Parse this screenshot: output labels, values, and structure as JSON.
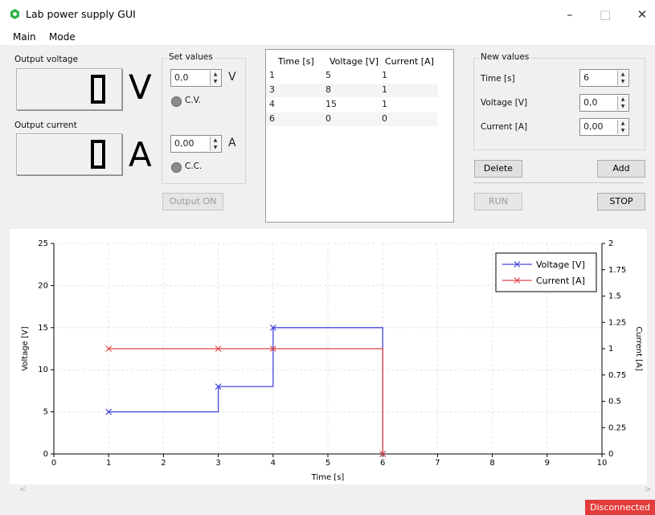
{
  "window": {
    "title": "Lab power supply GUI",
    "controls": [
      "–",
      "□",
      "✕"
    ]
  },
  "menu": {
    "items": [
      "Main",
      "Mode"
    ]
  },
  "output": {
    "voltage_label": "Output voltage",
    "voltage_digit": "0",
    "voltage_unit": "V",
    "current_label": "Output current",
    "current_digit": "0",
    "current_unit": "A"
  },
  "set_values": {
    "title": "Set values",
    "voltage_value": "0,0",
    "voltage_unit": "V",
    "cv_label": "C.V.",
    "current_value": "0,00",
    "current_unit": "A",
    "cc_label": "C.C.",
    "output_button": "Output ON"
  },
  "table": {
    "columns": [
      "Time [s]",
      "Voltage [V]",
      "Current [A]"
    ],
    "rows": [
      [
        "1",
        "5",
        "1"
      ],
      [
        "3",
        "8",
        "1"
      ],
      [
        "4",
        "15",
        "1"
      ],
      [
        "6",
        "0",
        "0"
      ]
    ]
  },
  "new_values": {
    "title": "New values",
    "time_label": "Time [s]",
    "time_value": "6",
    "voltage_label": "Voltage [V]",
    "voltage_value": "0,0",
    "current_label": "Current [A]",
    "current_value": "0,00",
    "delete_button": "Delete",
    "add_button": "Add",
    "run_button": "RUN",
    "stop_button": "STOP"
  },
  "status": {
    "text": "Disconnected"
  },
  "colors": {
    "voltage": "#4646e0",
    "current": "#e04646",
    "status": "#e23c3c"
  },
  "chart_data": {
    "type": "line",
    "xlabel": "Time [s]",
    "ylabel": "Voltage [V]",
    "y2label": "Current [A]",
    "xlim": [
      0,
      10
    ],
    "ylim": [
      0,
      25
    ],
    "y2lim": [
      0,
      2
    ],
    "xticks": [
      0,
      1,
      2,
      3,
      4,
      5,
      6,
      7,
      8,
      9,
      10
    ],
    "yticks": [
      0,
      5,
      10,
      15,
      20,
      25
    ],
    "y2ticks": [
      0,
      0.25,
      0.5,
      0.75,
      1,
      1.25,
      1.5,
      1.75,
      2
    ],
    "y2ticklabels": [
      "0",
      "0.25",
      "0.5",
      "0.75",
      "1",
      "1.25",
      "1.5",
      "1.75",
      "2"
    ],
    "grid": true,
    "legend": "top-right",
    "step": true,
    "series": [
      {
        "name": "Voltage [V]",
        "axis": "left",
        "color": "#4646e0",
        "x": [
          1,
          3,
          4,
          6
        ],
        "y": [
          5,
          8,
          15,
          0
        ]
      },
      {
        "name": "Current [A]",
        "axis": "right",
        "color": "#e04646",
        "x": [
          1,
          3,
          4,
          6
        ],
        "y": [
          1,
          1,
          1,
          0
        ]
      }
    ]
  }
}
